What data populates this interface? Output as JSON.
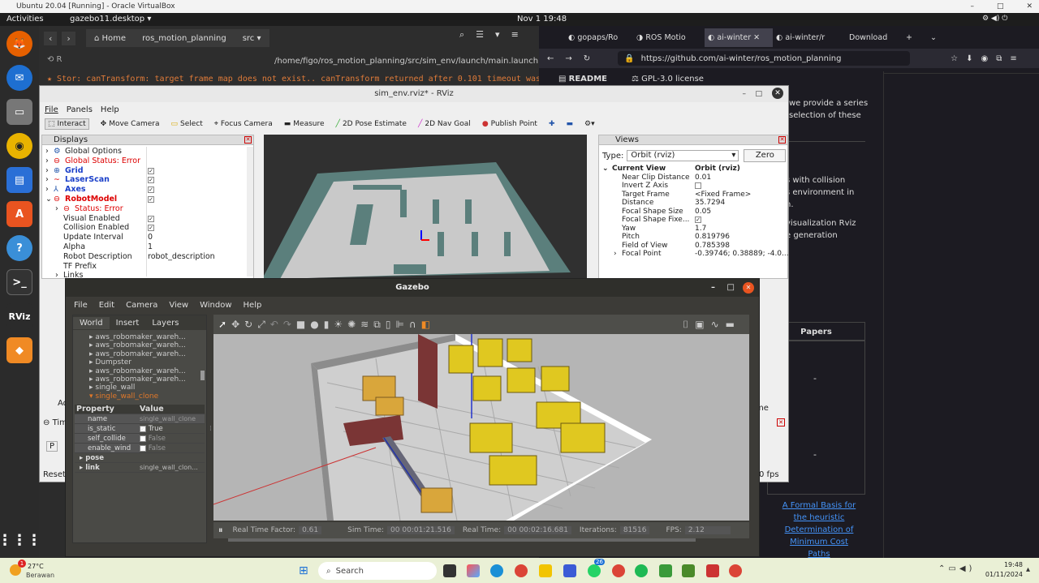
{
  "vbox": {
    "title": "Ubuntu 20.04 [Running] - Oracle VirtualBox"
  },
  "topbar": {
    "activities": "Activities",
    "app": "gazebo11.desktop",
    "clock": "Nov 1  19:48"
  },
  "nautilus": {
    "home": "Home",
    "path1": "ros_motion_planning",
    "path2": "src",
    "file_path": "/home/figo/ros_motion_planning/src/sim_env/launch/main.launch ht",
    "terminal_line": "Stor: canTransform: target frame map does not exist.. canTransform returned after 0.101 timeout was"
  },
  "firefox": {
    "tabs": [
      "gopaps/Ro",
      "ROS Motio",
      "ai-winter",
      "ai-winter/r",
      "Download"
    ],
    "url": "https://github.com/ai-winter/ros_motion_planning",
    "readme": "README",
    "license": "GPL-3.0 license",
    "text1": "we provide a series",
    "text2": "selection of these",
    "text3": "s with collision",
    "text4": "s environment in",
    "text5": "n.",
    "text6": "visualization Rviz",
    "text7": "e generation",
    "papers": "Papers",
    "dash1": "-",
    "dash2": "-",
    "link_lines": [
      "A Formal Basis for",
      "the heuristic",
      "Determination of",
      "Minimum Cost",
      "Paths"
    ],
    "fps_fragment": "0 fps",
    "name_fragment": "me"
  },
  "rviz": {
    "title": "sim_env.rviz* - RViz",
    "menu": [
      "File",
      "Panels",
      "Help"
    ],
    "tools": [
      "Interact",
      "Move Camera",
      "Select",
      "Focus Camera",
      "Measure",
      "2D Pose Estimate",
      "2D Nav Goal",
      "Publish Point"
    ],
    "displays_title": "Displays",
    "displays": [
      {
        "label": "Global Options",
        "color": "#222"
      },
      {
        "label": "Global Status: Error",
        "color": "#d00"
      },
      {
        "label": "Grid",
        "color": "#1a3fc9"
      },
      {
        "label": "LaserScan",
        "color": "#1a3fc9"
      },
      {
        "label": "Axes",
        "color": "#1a3fc9"
      },
      {
        "label": "RobotModel",
        "color": "#d00"
      },
      {
        "label": "Status: Error",
        "color": "#d00"
      },
      {
        "label": "Visual Enabled",
        "color": "#222"
      },
      {
        "label": "Collision Enabled",
        "color": "#222"
      },
      {
        "label": "Update Interval",
        "color": "#222"
      },
      {
        "label": "Alpha",
        "color": "#222"
      },
      {
        "label": "Robot Description",
        "color": "#222"
      },
      {
        "label": "TF Prefix",
        "color": "#222"
      },
      {
        "label": "Links",
        "color": "#222"
      }
    ],
    "display_values": [
      "",
      "",
      "",
      "",
      "",
      "",
      "",
      "",
      "",
      "0",
      "1",
      "robot_description",
      "",
      ""
    ],
    "views_title": "Views",
    "type_label": "Type:",
    "type_value": "Orbit (rviz)",
    "zero_button": "Zero",
    "view_props": [
      {
        "name": "Current View",
        "value": "Orbit (rviz)"
      },
      {
        "name": "Near Clip Distance",
        "value": "0.01"
      },
      {
        "name": "Invert Z Axis",
        "value": ""
      },
      {
        "name": "Target Frame",
        "value": "<Fixed Frame>"
      },
      {
        "name": "Distance",
        "value": "35.7294"
      },
      {
        "name": "Focal Shape Size",
        "value": "0.05"
      },
      {
        "name": "Focal Shape Fixe...",
        "value": ""
      },
      {
        "name": "Yaw",
        "value": "1.7"
      },
      {
        "name": "Pitch",
        "value": "0.819796"
      },
      {
        "name": "Field of View",
        "value": "0.785398"
      },
      {
        "name": "Focal Point",
        "value": "-0.39746; 0.38889; -4.0..."
      }
    ],
    "side_fragment_1": "Ad",
    "side_fragment_2": "Tim",
    "side_fragment_3": "P",
    "reset": "Reset"
  },
  "gazebo": {
    "title": "Gazebo",
    "menu": [
      "File",
      "Edit",
      "Camera",
      "View",
      "Window",
      "Help"
    ],
    "tabs": [
      "World",
      "Insert",
      "Layers"
    ],
    "tree": [
      "aws_robomaker_wareh...",
      "aws_robomaker_wareh...",
      "aws_robomaker_wareh...",
      "Dumpster",
      "aws_robomaker_wareh...",
      "aws_robomaker_wareh...",
      "single_wall",
      "single_wall_clone"
    ],
    "prop_header": [
      "Property",
      "Value"
    ],
    "props": [
      {
        "name": "name",
        "value": "single_wall_clone"
      },
      {
        "name": "is_static",
        "value": "True"
      },
      {
        "name": "self_collide",
        "value": "False"
      },
      {
        "name": "enable_wind",
        "value": "False"
      },
      {
        "name": "pose",
        "value": ""
      },
      {
        "name": "link",
        "value": "single_wall_clon..."
      }
    ],
    "stats": {
      "rtf_label": "Real Time Factor:",
      "rtf": "0.61",
      "sim_label": "Sim Time:",
      "sim": "00 00:01:21.516",
      "real_label": "Real Time:",
      "real": "00 00:02:16.681",
      "iter_label": "Iterations:",
      "iter": "81516",
      "fps_label": "FPS:",
      "fps": "2.12"
    }
  },
  "taskbar": {
    "weather_temp": "27°C",
    "weather_desc": "Berawan",
    "search": "Search",
    "badge": "26",
    "time": "19:48",
    "date": "01/11/2024",
    "notif": "1"
  }
}
